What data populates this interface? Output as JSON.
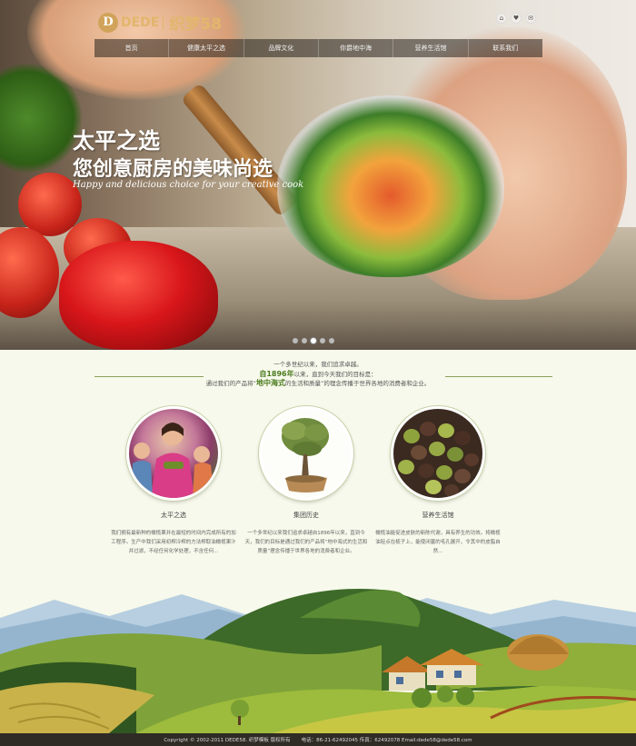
{
  "header": {
    "logo_mark": "D",
    "logo_brand": "DEDE",
    "logo_sub": "织梦58",
    "top_icons": [
      "home-icon",
      "favorite-icon",
      "mail-icon"
    ],
    "nav": [
      {
        "label": "首页"
      },
      {
        "label": "健康太平之选"
      },
      {
        "label": "品牌文化"
      },
      {
        "label": "你爵地中海"
      },
      {
        "label": "营养生活馆"
      },
      {
        "label": "联系我们"
      }
    ]
  },
  "hero": {
    "slogan_line1": "太平之选",
    "slogan_line2": "您创意厨房的美味尚选",
    "slogan_en": "Happy and delicious choice for your creative cook",
    "slides_total": 5,
    "slide_active": 2
  },
  "intro": {
    "line1": "一个多世纪以来，我们追求卓越。",
    "line2_highlight": "自1896年",
    "line2_rest": "以来，直到今天我们的目标是：",
    "line3_pre": "通过我们的产品将“",
    "line3_highlight": "地中海式",
    "line3_post": "的生活和质量”的理念传播于世界各地的消费者和企业。"
  },
  "features": [
    {
      "title": "太平之选",
      "desc": "我们拥有最新种的橄榄果并在最短的时间内完成所有的加工程序。生产中我们采用初榨冷榨的方法榨取油橄榄果汁并过滤，不经任何化学处理，不含任何..."
    },
    {
      "title": "集团历史",
      "desc": "一个多世纪以来我们追求卓越自1896年以来，直到今天，我们的目标是通过我们的产品将“地中海式的生活和质量”理念传播于世界各地的消费者和企业。"
    },
    {
      "title": "营养生活馆",
      "desc": "橄榄油能促进皮肤的新陈代谢，具有养生的功效。将橄榄油轻点在梳子上，能使闭塞的毛孔展开，令其中的皮脂自然..."
    }
  ],
  "footer": {
    "copyright": "Copyright © 2002-2011 DEDE58. 织梦模板 版权所有",
    "contact": "电话：86-21-62492045 传真：62492078 Email:dede58@dede58.com"
  }
}
